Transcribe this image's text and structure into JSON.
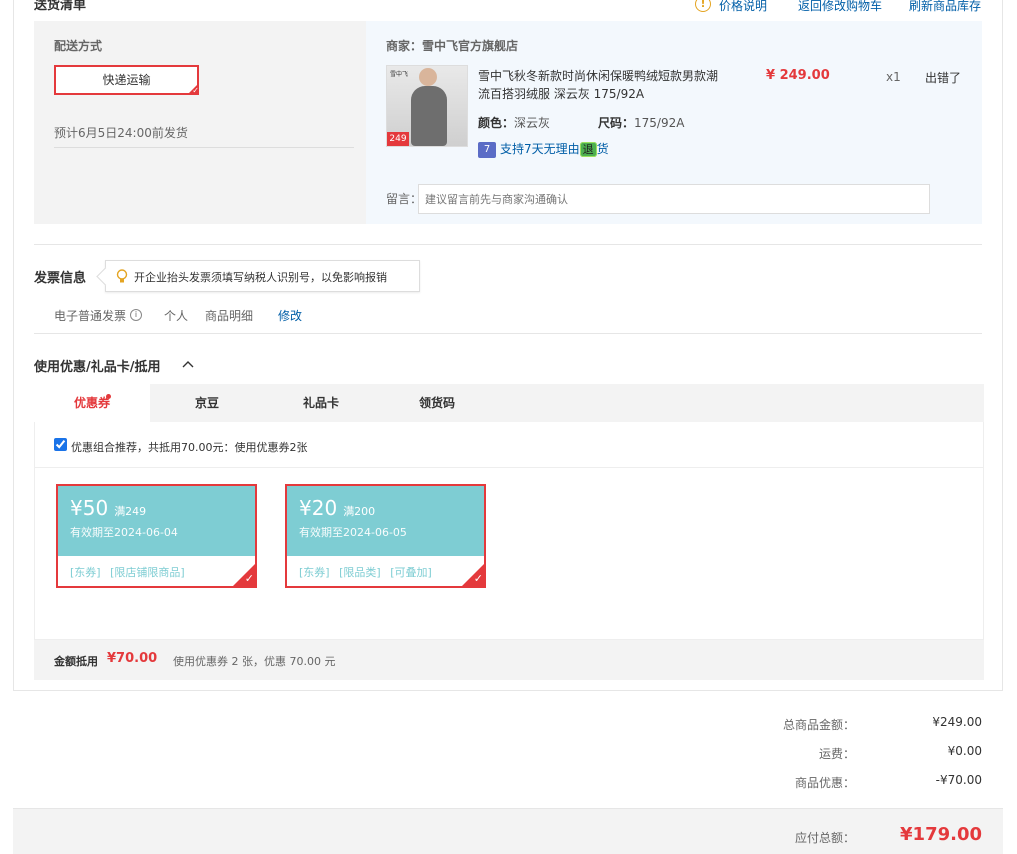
{
  "header": {
    "title": "送货清单",
    "price_note": "价格说明",
    "back_to_cart": "返回修改购物车",
    "refresh_stock": "刷新商品库存"
  },
  "shipping": {
    "label": "配送方式",
    "method": "快递运输",
    "estimate": "预计6月5日24:00前发货"
  },
  "item": {
    "merchant_label": "商家：",
    "merchant_name": "雪中飞官方旗舰店",
    "title_line1": "雪中飞秋冬新款时尚休闲保暖鸭绒短款男款潮",
    "title_line2": "流百搭羽绒服 深云灰 175/92A",
    "price": "¥ 249.00",
    "qty": "x1",
    "status": "出错了",
    "color_label": "颜色：",
    "color_value": "深云灰",
    "size_label": "尺码：",
    "size_value": "175/92A",
    "return_icon_text": "7",
    "return_prefix": "支持7天无理由",
    "return_mid": "退",
    "return_suffix": "货",
    "thumb_badge": "249",
    "thumb_brand": "雪中飞"
  },
  "message": {
    "label": "留言：",
    "placeholder": "建议留言前先与商家沟通确认"
  },
  "invoice": {
    "title": "发票信息",
    "tip": "开企业抬头发票须填写纳税人识别号，以免影响报销",
    "type": "电子普通发票",
    "info_icon_text": "i",
    "holder": "个人",
    "detail": "商品明细",
    "edit": "修改"
  },
  "discount": {
    "title": "使用优惠/礼品卡/抵用",
    "tabs": [
      {
        "label": "优惠券"
      },
      {
        "label": "京豆"
      },
      {
        "label": "礼品卡"
      },
      {
        "label": "领货码"
      }
    ],
    "combo_text": "优惠组合推荐，共抵用70.00元：使用优惠券2张",
    "coupons": [
      {
        "amount": "¥50",
        "condition": "满249",
        "expiry": "有效期至2024-06-04",
        "tag1": "[东券]",
        "tag2": "[限店铺限商品]",
        "tag3": ""
      },
      {
        "amount": "¥20",
        "condition": "满200",
        "expiry": "有效期至2024-06-05",
        "tag1": "[东券]",
        "tag2": "[限品类]",
        "tag3": "[可叠加]"
      }
    ],
    "summary_label": "金额抵用",
    "summary_amount": "¥70.00",
    "summary_text": "使用优惠券 2 张，优惠 70.00 元"
  },
  "totals": {
    "goods_label": "总商品金额：",
    "goods_value": "¥249.00",
    "shipping_label": "运费：",
    "shipping_value": "¥0.00",
    "discount_label": "商品优惠：",
    "discount_value": "-¥70.00",
    "payable_label": "应付总额：",
    "payable_value": "¥179.00"
  },
  "colors": {
    "accent_red": "#e4393c",
    "link_blue": "#005ea7",
    "coupon_teal": "#7ecdd3"
  }
}
